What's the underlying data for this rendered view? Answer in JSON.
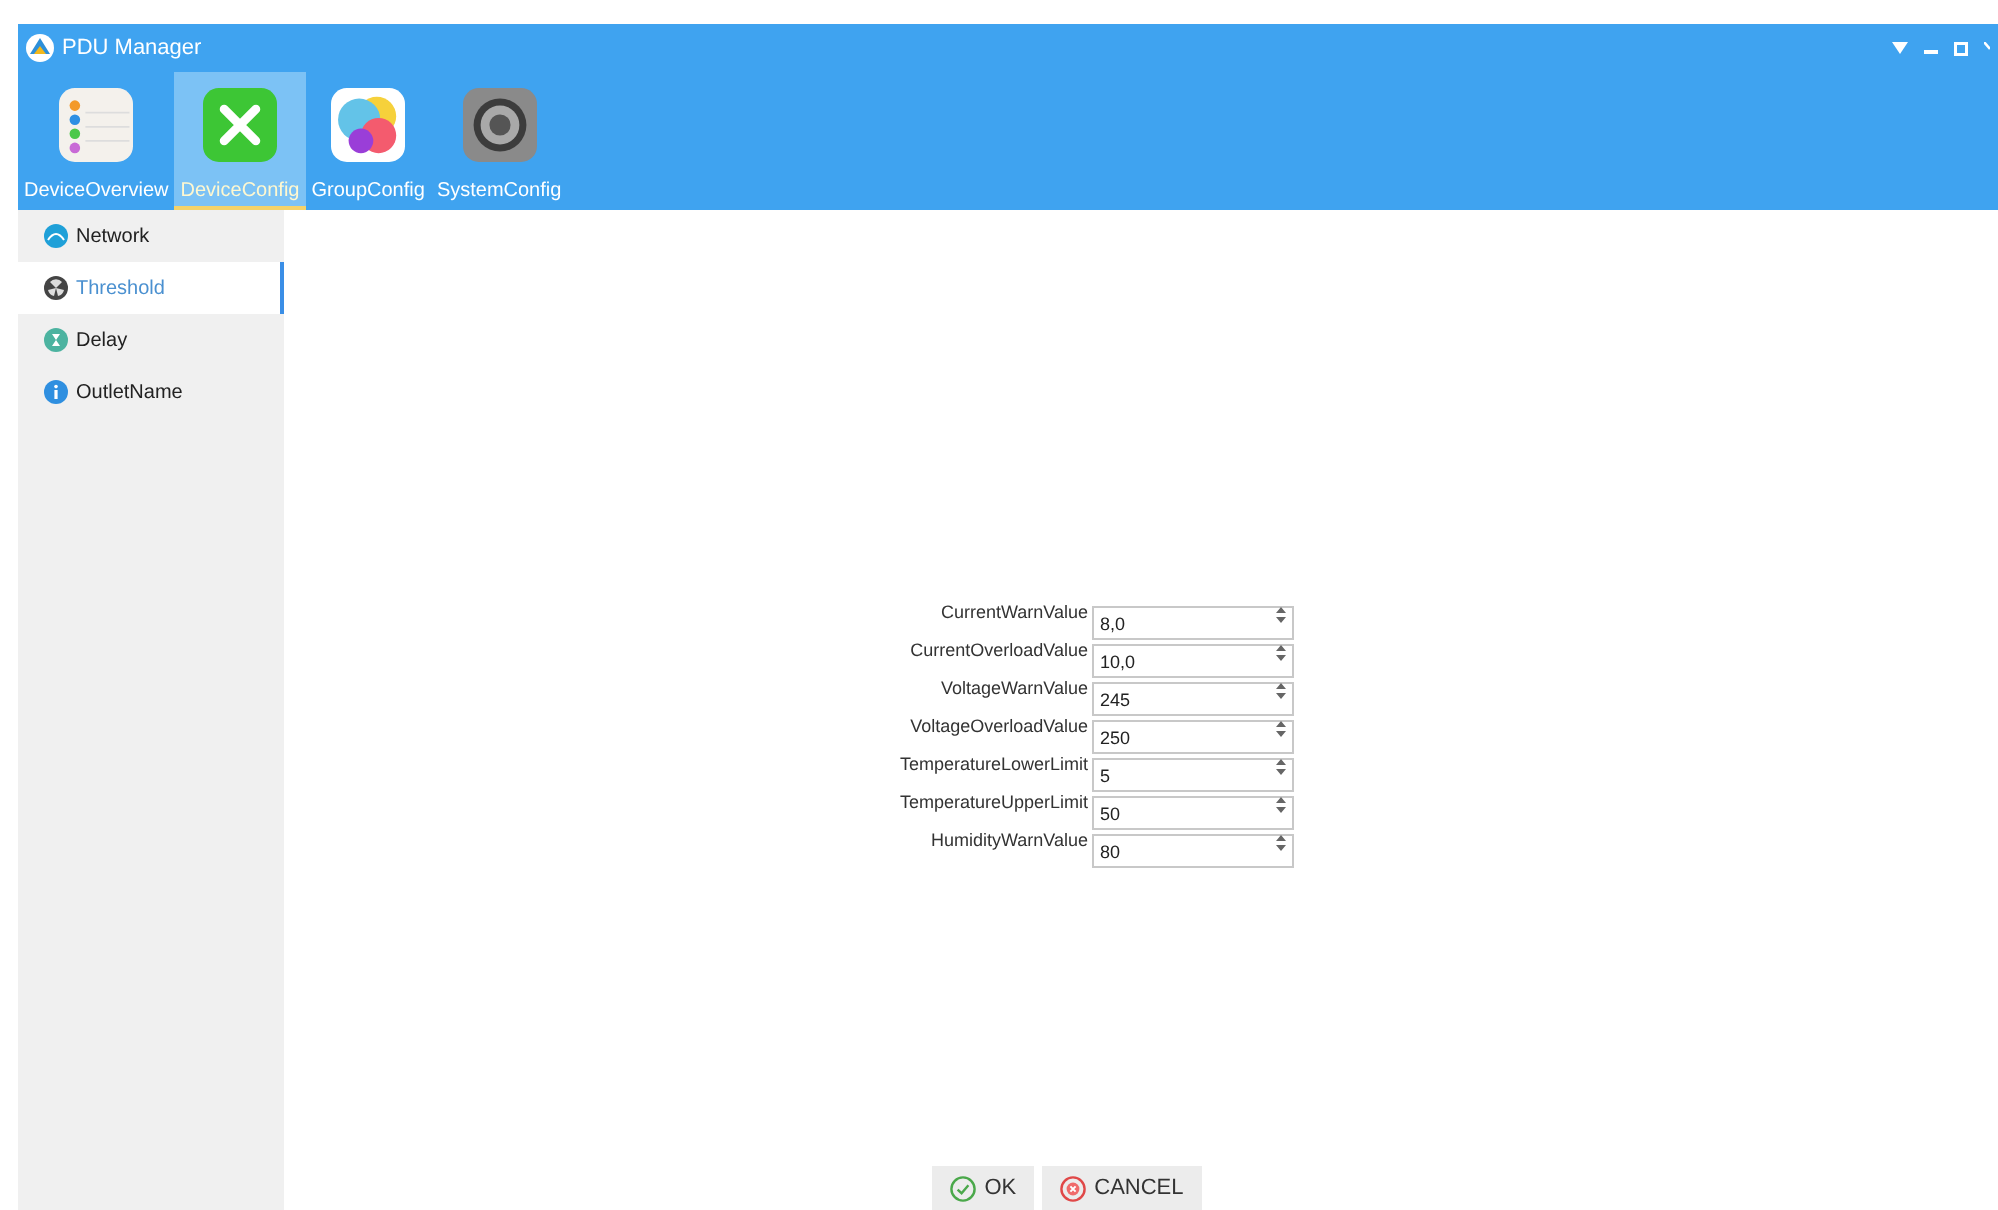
{
  "window": {
    "title": "PDU Manager"
  },
  "tabs": [
    {
      "label": "DeviceOverview",
      "kind": "list",
      "selected": false
    },
    {
      "label": "DeviceConfig",
      "kind": "tools",
      "selected": true
    },
    {
      "label": "GroupConfig",
      "kind": "circles",
      "selected": false
    },
    {
      "label": "SystemConfig",
      "kind": "gear",
      "selected": false
    }
  ],
  "sidebar": {
    "items": [
      {
        "label": "Network",
        "kind": "network",
        "selected": false
      },
      {
        "label": "Threshold",
        "kind": "threshold",
        "selected": true
      },
      {
        "label": "Delay",
        "kind": "delay",
        "selected": false
      },
      {
        "label": "OutletName",
        "kind": "info",
        "selected": false
      }
    ]
  },
  "form": {
    "fields": [
      {
        "label": "CurrentWarnValue",
        "value": "8,0"
      },
      {
        "label": "CurrentOverloadValue",
        "value": "10,0"
      },
      {
        "label": "VoltageWarnValue",
        "value": "245"
      },
      {
        "label": "VoltageOverloadValue",
        "value": "250"
      },
      {
        "label": "TemperatureLowerLimit",
        "value": "5"
      },
      {
        "label": "TemperatureUpperLimit",
        "value": "50"
      },
      {
        "label": "HumidityWarnValue",
        "value": "80"
      }
    ]
  },
  "buttons": [
    {
      "label": "OK",
      "kind": "ok"
    },
    {
      "label": "CANCEL",
      "kind": "cancel"
    }
  ]
}
